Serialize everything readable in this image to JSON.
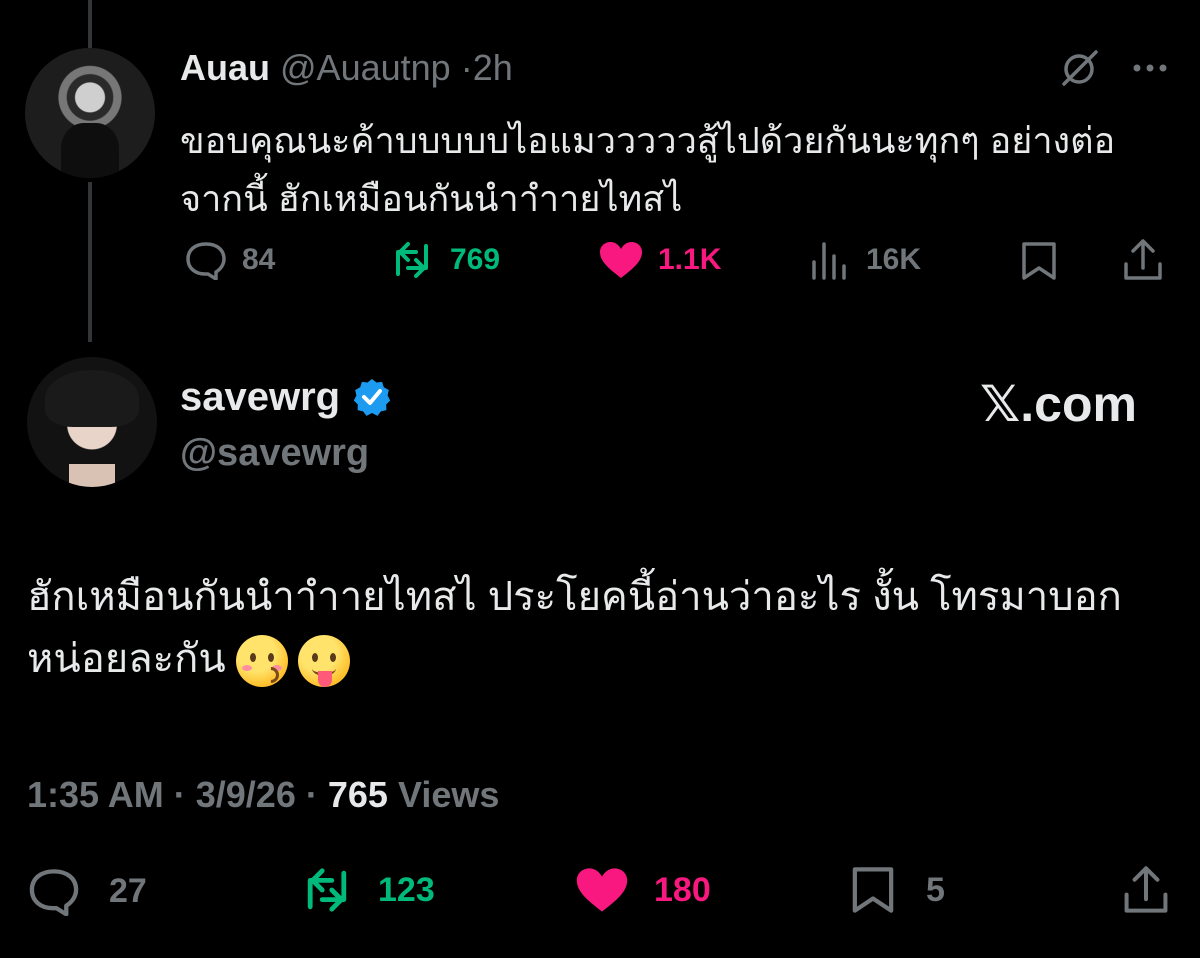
{
  "reply": {
    "name": "Auau",
    "handle": "@Auautnp",
    "separator": "·",
    "time": "2h",
    "text": "ขอบคุณนะค้าบบบบบไอแมวววววสู้ไปด้วยกันนะทุกๆ อย่างต่อจากนี้ ฮักเหมือนกันนำาําายไทสไ",
    "stats": {
      "replies": "84",
      "reposts": "769",
      "likes": "1.1K",
      "views": "16K"
    }
  },
  "main": {
    "name": "savewrg",
    "handle": "@savewrg",
    "watermark": "𝕏.com",
    "text": "ฮักเหมือนกันนำาําายไทสไ ประโยคนี้อ่านว่าอะไร งั้น โทรมาบอกหน่อยละกัน",
    "timestamp": {
      "time": "1:35 AM",
      "separator": "·",
      "date": "3/9/26",
      "views_count": "765",
      "views_label": "Views"
    },
    "stats": {
      "replies": "27",
      "reposts": "123",
      "likes": "180",
      "bookmarks": "5"
    }
  },
  "colors": {
    "repost": "#00ba7c",
    "like": "#f91880",
    "verified": "#1d9bf0",
    "muted": "#71767b",
    "text": "#e7e9ea"
  },
  "icons": [
    "grok-icon",
    "more-icon",
    "reply-icon",
    "repost-icon",
    "like-icon",
    "views-icon",
    "bookmark-icon",
    "share-icon",
    "verified-badge-icon",
    "kissing-face-emoji",
    "tongue-face-emoji"
  ]
}
